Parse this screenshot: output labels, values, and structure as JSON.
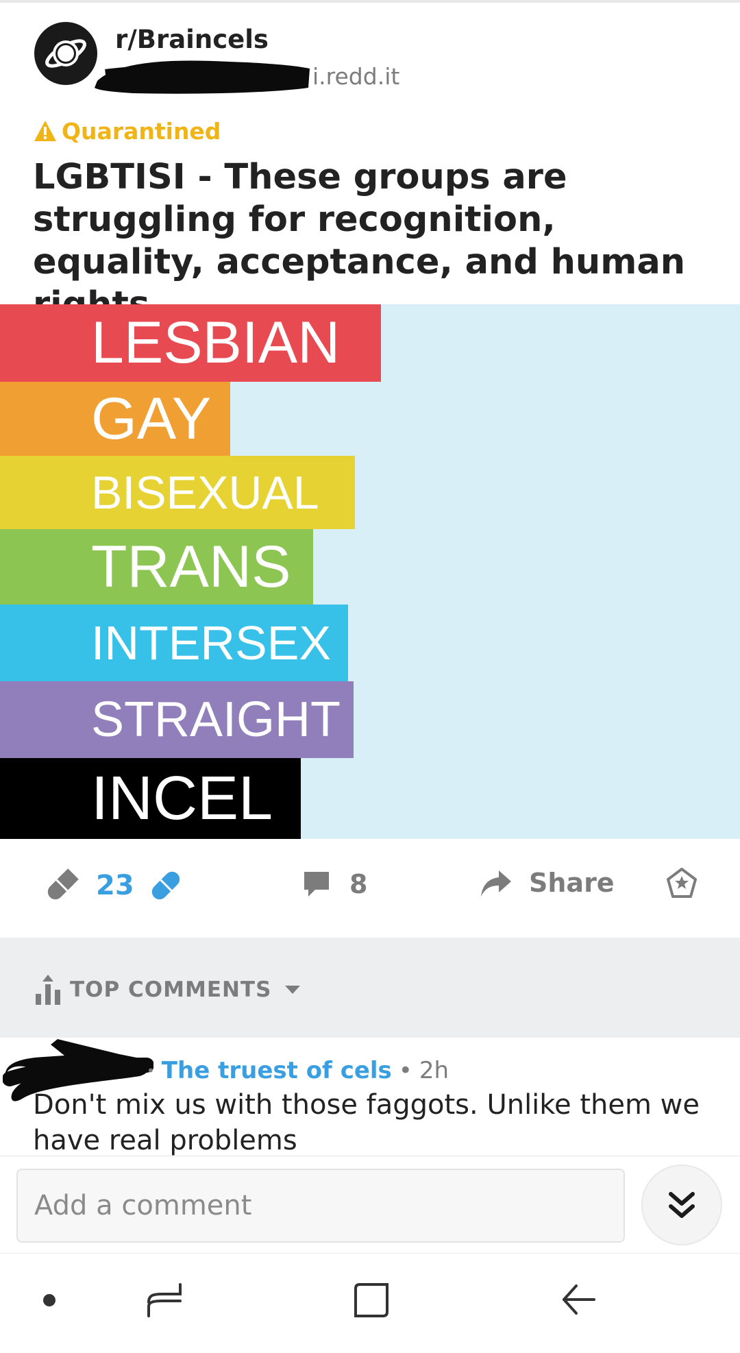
{
  "post": {
    "subreddit": "r/Braincels",
    "domain": "i.redd.it",
    "quarantine_label": "Quarantined",
    "title": "LGBTISI - These groups are struggling for recognition, equality, acceptance, and human rights.",
    "image": {
      "background_color": "#d9eff8",
      "bands": [
        {
          "label": "LESBIAN",
          "color": "#e84a52"
        },
        {
          "label": "GAY",
          "color": "#f0a033"
        },
        {
          "label": "BISEXUAL",
          "color": "#e6d232"
        },
        {
          "label": "TRANS",
          "color": "#8cc552"
        },
        {
          "label": "INTERSEX",
          "color": "#38c1e8"
        },
        {
          "label": "STRAIGHT",
          "color": "#917fbb"
        },
        {
          "label": "INCEL",
          "color": "#000000"
        }
      ]
    },
    "vote_count": "23",
    "comment_count": "8",
    "share_label": "Share"
  },
  "comments_section": {
    "sort_label": "TOP COMMENTS"
  },
  "comment": {
    "flair": "The truest of cels",
    "separator": "•",
    "age": "2h",
    "text": "Don't mix us with those faggots. Unlike them we have real problems"
  },
  "composer": {
    "placeholder": "Add a comment"
  },
  "colors": {
    "accent_blue": "#3a9fe0",
    "quarantine_yellow": "#f0b417",
    "muted_gray": "#7c7c7c"
  },
  "icons": {
    "vote": "pill-icon",
    "comment": "speech-bubble-icon",
    "share": "share-arrow-icon",
    "award": "award-icon",
    "sort": "bar-chart-icon",
    "jump": "double-chevron-down-icon"
  }
}
